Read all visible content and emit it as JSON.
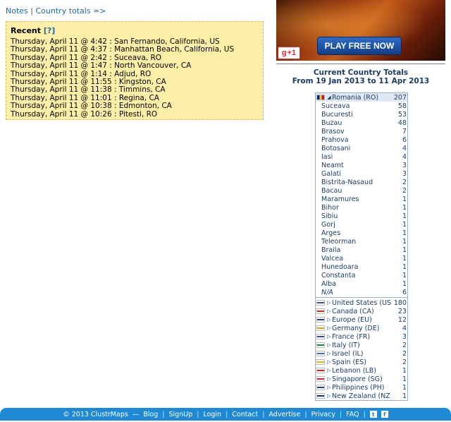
{
  "links": {
    "notes": "Notes",
    "sep": "|",
    "totals": "Country totals =>"
  },
  "recent": {
    "title": "Recent",
    "help": "[?]",
    "rows": [
      "Thursday, April 11 @ 4:42 : San Fernando, California, US",
      "Thursday, April 11 @ 4:37 : Manhattan Beach, California, US",
      "Thursday, April 11 @ 2:42 : Suceava, RO",
      "Thursday, April 11 @ 1:47 : North Vancouver, CA",
      "Thursday, April 11 @ 1:14 : Adjud, RO",
      "Thursday, April 11 @ 11:55 : Kingston, CA",
      "Thursday, April 11 @ 11:38 : Timmins, CA",
      "Thursday, April 11 @ 11:01 : Regina, CA",
      "Thursday, April 11 @ 10:38 : Edmonton, CA",
      "Thursday, April 11 @ 10:26 : Pitesti, RO"
    ]
  },
  "ad": {
    "play_label": "PLAY FREE NOW",
    "gplus_label": "+1"
  },
  "totals": {
    "title": "Current Country Totals",
    "range": "From 19 Jan 2013 to 11 Apr 2013"
  },
  "romania": {
    "name": "Romania (RO)",
    "count": "207"
  },
  "regions": [
    {
      "name": "Suceava",
      "count": "58"
    },
    {
      "name": "Bucuresti",
      "count": "53"
    },
    {
      "name": "Buzau",
      "count": "48"
    },
    {
      "name": "Brasov",
      "count": "7"
    },
    {
      "name": "Prahova",
      "count": "6"
    },
    {
      "name": "Botosani",
      "count": "4"
    },
    {
      "name": "Iasi",
      "count": "4"
    },
    {
      "name": "Neamt",
      "count": "3"
    },
    {
      "name": "Galati",
      "count": "3"
    },
    {
      "name": "Bistrita-Nasaud",
      "count": "2"
    },
    {
      "name": "Bacau",
      "count": "2"
    },
    {
      "name": "Maramures",
      "count": "1"
    },
    {
      "name": "Bihor",
      "count": "1"
    },
    {
      "name": "Sibiu",
      "count": "1"
    },
    {
      "name": "Gorj",
      "count": "1"
    },
    {
      "name": "Arges",
      "count": "1"
    },
    {
      "name": "Teleorman",
      "count": "1"
    },
    {
      "name": "Braila",
      "count": "1"
    },
    {
      "name": "Valcea",
      "count": "1"
    },
    {
      "name": "Hunedoara",
      "count": "1"
    },
    {
      "name": "Constanta",
      "count": "1"
    },
    {
      "name": "Alba",
      "count": "1"
    },
    {
      "name": "N/A",
      "count": "6"
    }
  ],
  "countries": [
    {
      "name": "United States (US)",
      "count": "180",
      "flag": "#3c4f9c"
    },
    {
      "name": "Canada (CA)",
      "count": "23",
      "flag": "#d52b1e"
    },
    {
      "name": "Europe (EU)",
      "count": "12",
      "flag": "#1d3f9e"
    },
    {
      "name": "Germany (DE)",
      "count": "4",
      "flag": "#d9a400"
    },
    {
      "name": "France (FR)",
      "count": "3",
      "flag": "#2b4ea2"
    },
    {
      "name": "Italy (IT)",
      "count": "2",
      "flag": "#0b8a3c"
    },
    {
      "name": "Israel (IL)",
      "count": "2",
      "flag": "#3a67c8"
    },
    {
      "name": "Spain (ES)",
      "count": "2",
      "flag": "#e8b400"
    },
    {
      "name": "Lebanon (LB)",
      "count": "1",
      "flag": "#d01e1e"
    },
    {
      "name": "Singapore (SG)",
      "count": "1",
      "flag": "#e02030"
    },
    {
      "name": "Philippines (PH)",
      "count": "1",
      "flag": "#1c3f9c"
    },
    {
      "name": "New Zealand (NZ)",
      "count": "1",
      "flag": "#1a2f7a"
    }
  ],
  "footer": {
    "copyright": "© 2013 ClustrMaps",
    "dash": "—",
    "items": [
      "Blog",
      "SignUp",
      "Login",
      "Contact",
      "Advertise",
      "Privacy",
      "FAQ"
    ],
    "pipe": "|",
    "twitter": "t",
    "facebook": "f"
  }
}
